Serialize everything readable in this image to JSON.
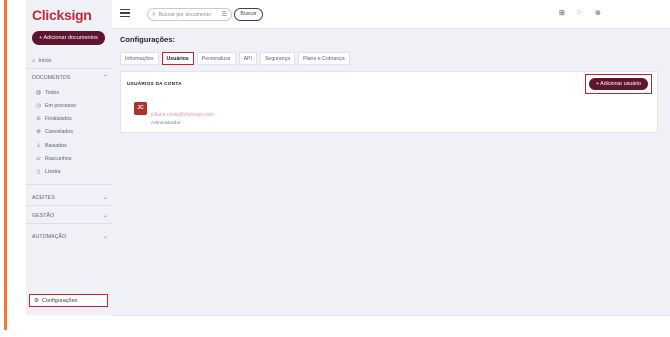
{
  "app": {
    "logo": "Clicksign"
  },
  "sidebar": {
    "add_documents": "+ Adicionar documentos",
    "home": "Início",
    "documents_section": "DOCUMENTOS",
    "documents_items": [
      {
        "label": "Todos",
        "icon": "spiral-icon"
      },
      {
        "label": "Em processo",
        "icon": "clock-icon"
      },
      {
        "label": "Finalizados",
        "icon": "check-circle-icon"
      },
      {
        "label": "Cancelados",
        "icon": "cancel-circle-icon"
      },
      {
        "label": "Baixados",
        "icon": "download-icon"
      },
      {
        "label": "Rascunhos",
        "icon": "draft-icon"
      },
      {
        "label": "Lixeira",
        "icon": "trash-icon"
      }
    ],
    "aceites": "ACEITES",
    "gestao": "GESTÃO",
    "automacao": "AUTOMAÇÃO",
    "settings": "Configurações"
  },
  "topbar": {
    "search_placeholder": "Buscar por documento",
    "search_button": "Buscar"
  },
  "main": {
    "title": "Configurações:",
    "tabs": [
      {
        "label": "Informações",
        "active": false
      },
      {
        "label": "Usuários",
        "active": true
      },
      {
        "label": "Personalizar",
        "active": false
      },
      {
        "label": "API",
        "active": false
      },
      {
        "label": "Segurança",
        "active": false
      },
      {
        "label": "Plano e Cobrança",
        "active": false
      }
    ],
    "panel_title": "USUÁRIOS DA CONTA",
    "add_user": "+ Adicionar usuário",
    "user": {
      "initials": "JC",
      "email": "juliana.costa@clicksign.com",
      "role": "Administrador"
    }
  },
  "colors": {
    "brand": "#bf2b3b",
    "button": "#5e1630",
    "highlight": "#c6232f",
    "accent_bar": "#f07a2e"
  }
}
